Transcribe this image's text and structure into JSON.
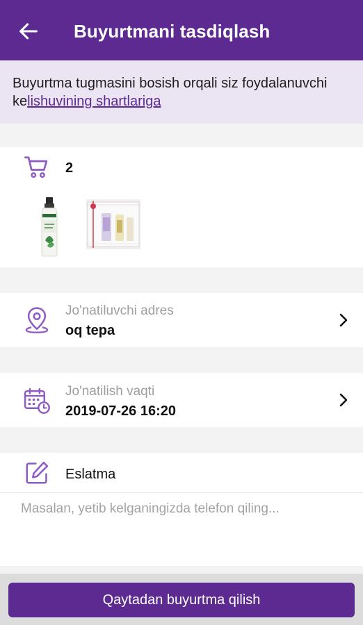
{
  "header": {
    "title": "Buyurtmani tasdiqlash"
  },
  "notice": {
    "text": "Buyurtma tugmasini bosish orqali siz foydalanuvchi ke",
    "link": "lishuvining shartlariga"
  },
  "cart": {
    "count": "2"
  },
  "address": {
    "label": "Jo'natiluvchi adres",
    "value": "oq tepa"
  },
  "delivery_time": {
    "label": "Jo'natilish vaqti",
    "value": "2019-07-26 16:20"
  },
  "note": {
    "label": "Eslatma",
    "placeholder": "Masalan, yetib kelganingizda telefon qiling...",
    "value": ""
  },
  "footer": {
    "reorder_label": "Qaytadan buyurtma qilish"
  },
  "colors": {
    "primary": "#5c2a91",
    "notice_bg": "#ebe4f3",
    "icon_accent": "#8e5cc4"
  },
  "icons": {
    "back": "arrow-left",
    "cart": "shopping-cart",
    "address": "map-pin",
    "time": "calendar-clock",
    "note": "edit",
    "chevron": "chevron-right"
  }
}
